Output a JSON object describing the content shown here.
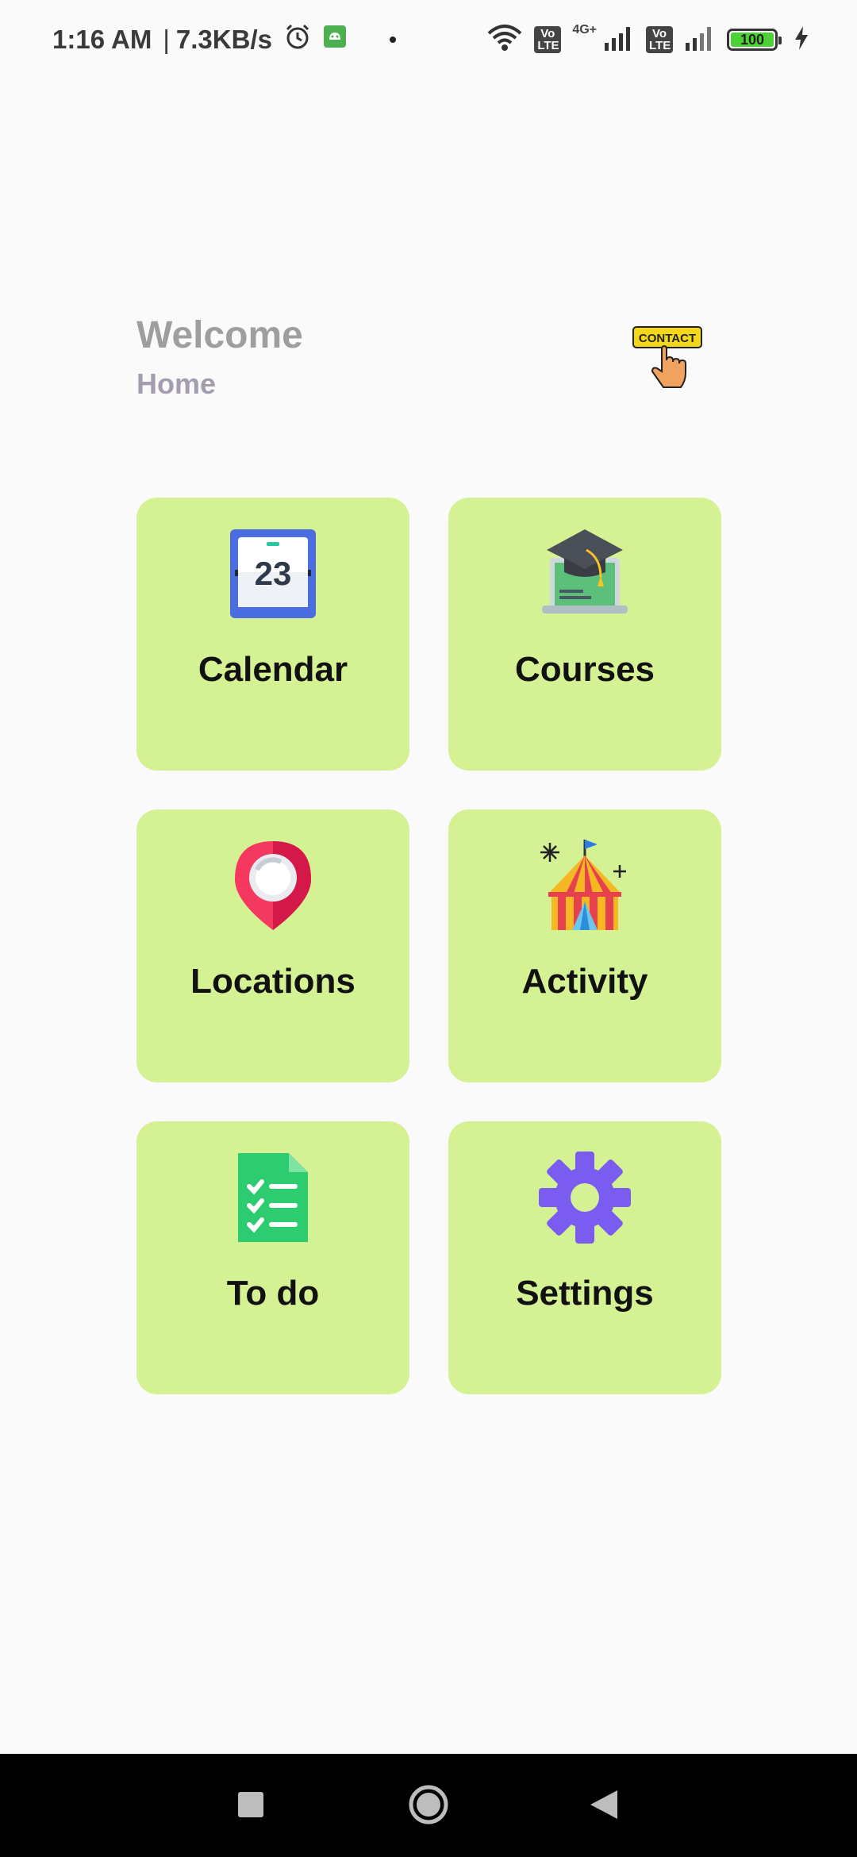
{
  "status_bar": {
    "time": "1:16 AM",
    "separator": "|",
    "net_speed": "7.3KB/s",
    "sim1_badge": "Vo LTE",
    "sim1_tech": "4G+",
    "sim2_badge": "Vo LTE",
    "battery_level": "100",
    "icons": [
      "alarm-icon",
      "android-notification-icon",
      "wifi-icon",
      "signal-icon",
      "charging-icon"
    ]
  },
  "header": {
    "title": "Welcome",
    "subtitle": "Home",
    "contact_label": "CONTACT"
  },
  "tiles": [
    {
      "label": "Calendar",
      "icon": "calendar-icon",
      "calendar_day": "23"
    },
    {
      "label": "Courses",
      "icon": "graduation-laptop-icon"
    },
    {
      "label": "Locations",
      "icon": "location-pin-icon"
    },
    {
      "label": "Activity",
      "icon": "circus-tent-icon"
    },
    {
      "label": "To do",
      "icon": "checklist-icon"
    },
    {
      "label": "Settings",
      "icon": "gear-icon"
    }
  ],
  "colors": {
    "tile_bg": "#d4f193",
    "title_color": "#9e9e9e",
    "subtitle_color": "#a49db0",
    "background": "#fafafa"
  },
  "nav_bar": {
    "buttons": [
      "recents-button",
      "home-button",
      "back-button"
    ]
  }
}
